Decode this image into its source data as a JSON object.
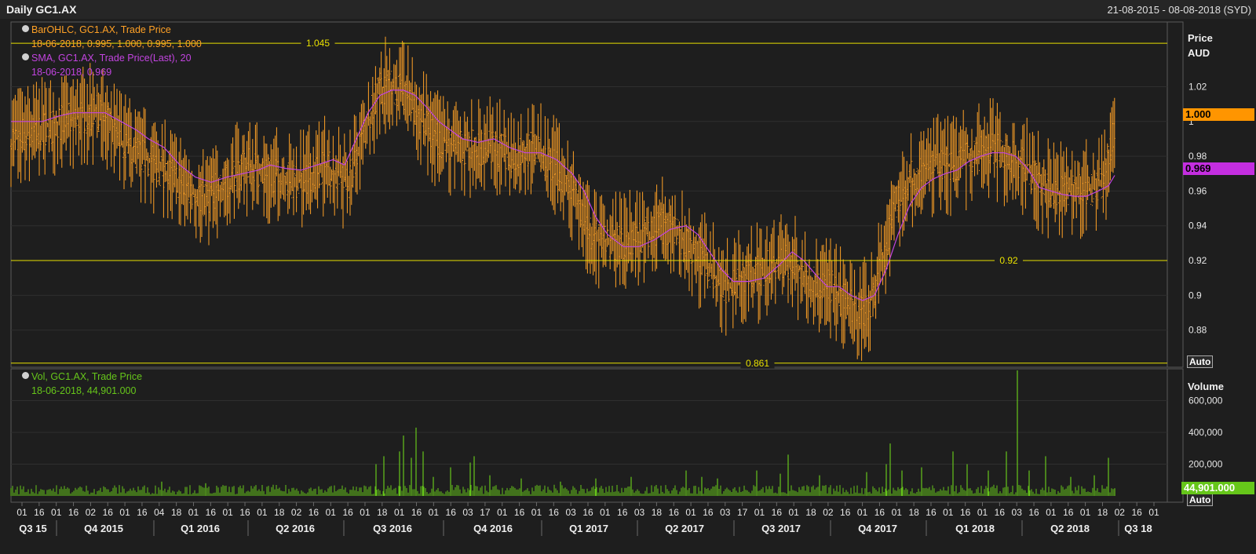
{
  "header": {
    "title": "Daily GC1.AX",
    "date_range": "21-08-2015 - 08-08-2018 (SYD)"
  },
  "legend": {
    "bar": {
      "label": "BarOHLC, GC1.AX, Trade Price",
      "values": "18-06-2018, 0.995, 1.000, 0.995, 1.000",
      "color": "#ffa126"
    },
    "sma": {
      "label": "SMA, GC1.AX, Trade Price(Last),  20",
      "values": "18-06-2018, 0.969",
      "color": "#c244e0"
    },
    "vol": {
      "label": "Vol, GC1.AX, Trade Price",
      "values": "18-06-2018, 44,901.000",
      "color": "#66c61a"
    }
  },
  "price_axis": {
    "title1": "Price",
    "title2": "AUD",
    "auto": "Auto"
  },
  "volume_axis": {
    "title": "Volume",
    "auto": "Auto"
  },
  "last_price_tag": "1.000",
  "sma_tag": "0.969",
  "volume_tag": "44,901.000",
  "ref_lines": [
    {
      "label": "1.045",
      "value": 1.045
    },
    {
      "label": "0.92",
      "value": 0.92
    },
    {
      "label": "0.861",
      "value": 0.861
    }
  ],
  "chart_data": [
    {
      "type": "ohlc",
      "title": "Daily GC1.AX",
      "ylabel": "Price AUD",
      "ylim": [
        0.86,
        1.05
      ],
      "yticks": [
        "1.02",
        "1",
        "0.98",
        "0.96",
        "0.94",
        "0.92",
        "0.9",
        "0.88"
      ],
      "grid": true,
      "x_tick_labels": [
        "01",
        "16",
        "01",
        "16",
        "02",
        "16",
        "01",
        "16",
        "04",
        "18",
        "01",
        "16",
        "01",
        "16",
        "01",
        "18",
        "02",
        "16",
        "01",
        "16",
        "01",
        "18",
        "01",
        "16",
        "01",
        "16",
        "03",
        "17",
        "01",
        "16",
        "01",
        "16",
        "03",
        "16",
        "01",
        "16",
        "03",
        "18",
        "16",
        "01",
        "16",
        "03",
        "17",
        "01",
        "16",
        "01",
        "18",
        "02",
        "16",
        "01",
        "16",
        "01",
        "18",
        "16",
        "01",
        "16",
        "01",
        "16",
        "03",
        "16",
        "01",
        "16",
        "01",
        "18",
        "02",
        "16",
        "01"
      ],
      "quarters": [
        "Q3 15",
        "Q4 2015",
        "Q1 2016",
        "Q2 2016",
        "Q3 2016",
        "Q4 2016",
        "Q1 2017",
        "Q2 2017",
        "Q3 2017",
        "Q4 2017",
        "Q1 2018",
        "Q2 2018",
        "Q3 18"
      ],
      "price_path": [
        [
          0,
          0.99
        ],
        [
          35,
          0.995
        ],
        [
          70,
          1.0
        ],
        [
          110,
          1.005
        ],
        [
          150,
          0.985
        ],
        [
          185,
          0.975
        ],
        [
          215,
          0.965
        ],
        [
          245,
          0.955
        ],
        [
          275,
          0.965
        ],
        [
          300,
          0.975
        ],
        [
          330,
          0.97
        ],
        [
          365,
          0.965
        ],
        [
          400,
          0.975
        ],
        [
          430,
          0.965
        ],
        [
          455,
          1.0
        ],
        [
          470,
          1.02
        ],
        [
          485,
          1.02
        ],
        [
          505,
          1.015
        ],
        [
          525,
          1.0
        ],
        [
          545,
          0.99
        ],
        [
          565,
          0.985
        ],
        [
          590,
          0.985
        ],
        [
          615,
          0.985
        ],
        [
          640,
          0.98
        ],
        [
          665,
          0.985
        ],
        [
          690,
          0.975
        ],
        [
          710,
          0.965
        ],
        [
          725,
          0.95
        ],
        [
          740,
          0.935
        ],
        [
          760,
          0.93
        ],
        [
          780,
          0.93
        ],
        [
          805,
          0.935
        ],
        [
          830,
          0.94
        ],
        [
          850,
          0.935
        ],
        [
          870,
          0.925
        ],
        [
          890,
          0.915
        ],
        [
          910,
          0.905
        ],
        [
          935,
          0.91
        ],
        [
          960,
          0.915
        ],
        [
          985,
          0.92
        ],
        [
          1005,
          0.915
        ],
        [
          1025,
          0.905
        ],
        [
          1045,
          0.905
        ],
        [
          1065,
          0.895
        ],
        [
          1080,
          0.89
        ],
        [
          1095,
          0.895
        ],
        [
          1110,
          0.92
        ],
        [
          1125,
          0.95
        ],
        [
          1140,
          0.965
        ],
        [
          1160,
          0.97
        ],
        [
          1180,
          0.975
        ],
        [
          1200,
          0.975
        ],
        [
          1225,
          0.98
        ],
        [
          1250,
          0.985
        ],
        [
          1270,
          0.98
        ],
        [
          1290,
          0.975
        ],
        [
          1310,
          0.965
        ],
        [
          1330,
          0.96
        ],
        [
          1350,
          0.96
        ],
        [
          1370,
          0.96
        ],
        [
          1390,
          0.965
        ],
        [
          1400,
          0.98
        ],
        [
          1406,
          1.0
        ]
      ],
      "sma_path": [
        [
          0,
          1.0
        ],
        [
          20,
          1.0
        ],
        [
          40,
          1.0
        ],
        [
          60,
          1.003
        ],
        [
          80,
          1.005
        ],
        [
          100,
          1.005
        ],
        [
          120,
          1.005
        ],
        [
          140,
          1.0
        ],
        [
          160,
          0.995
        ],
        [
          175,
          0.99
        ],
        [
          195,
          0.985
        ],
        [
          215,
          0.975
        ],
        [
          235,
          0.968
        ],
        [
          255,
          0.965
        ],
        [
          275,
          0.968
        ],
        [
          295,
          0.97
        ],
        [
          315,
          0.972
        ],
        [
          330,
          0.975
        ],
        [
          350,
          0.973
        ],
        [
          370,
          0.972
        ],
        [
          390,
          0.975
        ],
        [
          410,
          0.978
        ],
        [
          425,
          0.975
        ],
        [
          440,
          0.99
        ],
        [
          455,
          1.005
        ],
        [
          470,
          1.015
        ],
        [
          485,
          1.018
        ],
        [
          500,
          1.018
        ],
        [
          515,
          1.015
        ],
        [
          530,
          1.008
        ],
        [
          545,
          1.0
        ],
        [
          560,
          0.995
        ],
        [
          575,
          0.99
        ],
        [
          595,
          0.988
        ],
        [
          615,
          0.99
        ],
        [
          635,
          0.985
        ],
        [
          655,
          0.982
        ],
        [
          675,
          0.982
        ],
        [
          695,
          0.978
        ],
        [
          715,
          0.97
        ],
        [
          730,
          0.96
        ],
        [
          745,
          0.945
        ],
        [
          760,
          0.935
        ],
        [
          780,
          0.928
        ],
        [
          800,
          0.928
        ],
        [
          820,
          0.932
        ],
        [
          840,
          0.938
        ],
        [
          860,
          0.94
        ],
        [
          875,
          0.935
        ],
        [
          890,
          0.925
        ],
        [
          905,
          0.915
        ],
        [
          920,
          0.908
        ],
        [
          940,
          0.908
        ],
        [
          960,
          0.91
        ],
        [
          980,
          0.918
        ],
        [
          995,
          0.925
        ],
        [
          1010,
          0.92
        ],
        [
          1025,
          0.912
        ],
        [
          1040,
          0.905
        ],
        [
          1055,
          0.905
        ],
        [
          1070,
          0.9
        ],
        [
          1085,
          0.897
        ],
        [
          1100,
          0.9
        ],
        [
          1115,
          0.915
        ],
        [
          1130,
          0.935
        ],
        [
          1145,
          0.952
        ],
        [
          1160,
          0.962
        ],
        [
          1175,
          0.967
        ],
        [
          1190,
          0.97
        ],
        [
          1205,
          0.972
        ],
        [
          1220,
          0.977
        ],
        [
          1235,
          0.98
        ],
        [
          1250,
          0.982
        ],
        [
          1265,
          0.982
        ],
        [
          1280,
          0.98
        ],
        [
          1295,
          0.973
        ],
        [
          1310,
          0.962
        ],
        [
          1325,
          0.96
        ],
        [
          1340,
          0.958
        ],
        [
          1355,
          0.957
        ],
        [
          1370,
          0.957
        ],
        [
          1385,
          0.96
        ],
        [
          1398,
          0.963
        ],
        [
          1406,
          0.969
        ]
      ]
    },
    {
      "type": "bar",
      "title": "Vol, GC1.AX, Trade Price",
      "ylabel": "Volume",
      "ylim": [
        0,
        800000
      ],
      "yticks": [
        "600,000",
        "400,000",
        "200,000"
      ],
      "spikes": [
        [
          192,
          90000
        ],
        [
          248,
          80000
        ],
        [
          465,
          200000
        ],
        [
          475,
          250000
        ],
        [
          495,
          280000
        ],
        [
          500,
          380000
        ],
        [
          510,
          240000
        ],
        [
          516,
          430000
        ],
        [
          525,
          280000
        ],
        [
          538,
          120000
        ],
        [
          560,
          180000
        ],
        [
          585,
          210000
        ],
        [
          590,
          250000
        ],
        [
          610,
          130000
        ],
        [
          650,
          110000
        ],
        [
          700,
          90000
        ],
        [
          745,
          110000
        ],
        [
          790,
          120000
        ],
        [
          860,
          160000
        ],
        [
          880,
          120000
        ],
        [
          900,
          110000
        ],
        [
          950,
          160000
        ],
        [
          980,
          140000
        ],
        [
          990,
          260000
        ],
        [
          1030,
          130000
        ],
        [
          1090,
          150000
        ],
        [
          1115,
          200000
        ],
        [
          1120,
          330000
        ],
        [
          1135,
          160000
        ],
        [
          1160,
          180000
        ],
        [
          1200,
          280000
        ],
        [
          1218,
          200000
        ],
        [
          1245,
          160000
        ],
        [
          1268,
          280000
        ],
        [
          1282,
          790000
        ],
        [
          1297,
          160000
        ],
        [
          1318,
          250000
        ],
        [
          1350,
          120000
        ],
        [
          1380,
          130000
        ],
        [
          1398,
          240000
        ],
        [
          1406,
          44901
        ]
      ]
    }
  ]
}
